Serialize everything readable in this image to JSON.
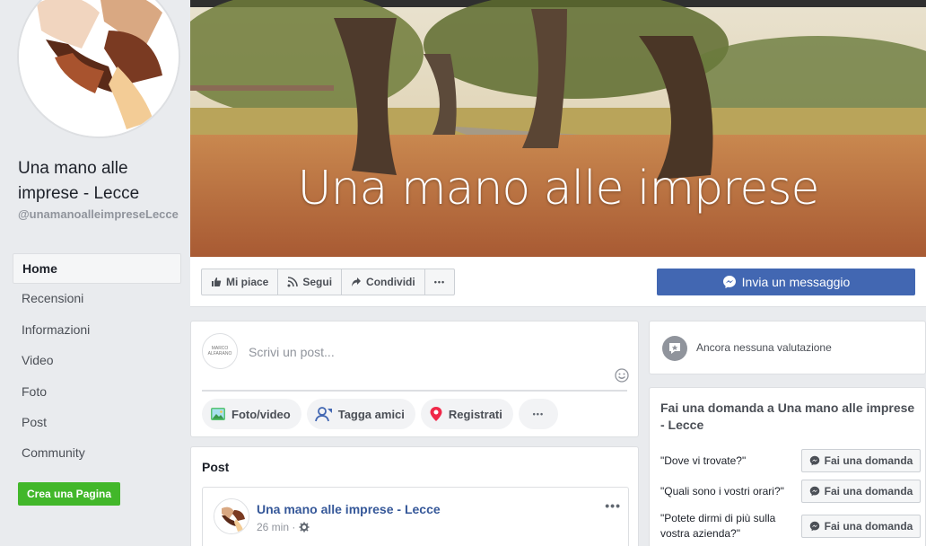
{
  "sidebar": {
    "page_name": "Una mano alle imprese - Lecce",
    "handle": "@unamanoalleimpreseLecce",
    "nav": [
      {
        "label": "Home",
        "active": true
      },
      {
        "label": "Recensioni",
        "active": false
      },
      {
        "label": "Informazioni",
        "active": false
      },
      {
        "label": "Video",
        "active": false
      },
      {
        "label": "Foto",
        "active": false
      },
      {
        "label": "Post",
        "active": false
      },
      {
        "label": "Community",
        "active": false
      }
    ],
    "create_page": "Crea una Pagina"
  },
  "cover": {
    "title": "Una mano alle imprese"
  },
  "actions": {
    "like": "Mi piace",
    "follow": "Segui",
    "share": "Condividi",
    "more": "•••",
    "message": "Invia un messaggio"
  },
  "composer": {
    "avatar_text": "MARCO ALFARANO",
    "placeholder": "Scrivi un post...",
    "photo_video": "Foto/video",
    "tag_friends": "Tagga amici",
    "check_in": "Registrati",
    "more": "•••"
  },
  "posts": {
    "title": "Post",
    "first": {
      "author": "Una mano alle imprese - Lecce",
      "time": "26 min ·",
      "more": "•••"
    }
  },
  "reviews": {
    "text": "Ancora nessuna valutazione"
  },
  "ask": {
    "title": "Fai una domanda a Una mano alle imprese - Lecce",
    "questions": [
      {
        "text": "\"Dove vi trovate?\"",
        "button": "Fai una domanda"
      },
      {
        "text": "\"Quali sono i vostri orari?\"",
        "button": "Fai una domanda"
      },
      {
        "text": "\"Potete dirmi di più sulla vostra azienda?\"",
        "button": "Fai una domanda"
      }
    ]
  },
  "colors": {
    "brand_blue": "#4267b2",
    "link_blue": "#365899",
    "green": "#42b72a",
    "background": "#e9ebee"
  }
}
